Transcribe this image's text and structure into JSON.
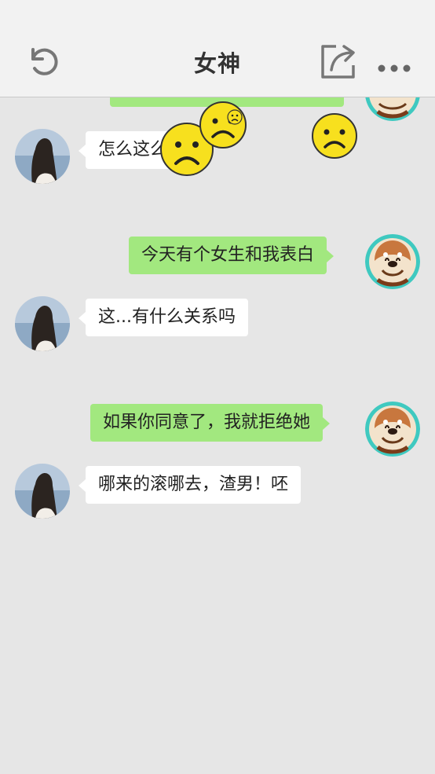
{
  "header": {
    "title": "女神",
    "back_icon": "refresh-back-icon",
    "share_icon": "share-icon",
    "more_icon": "more-dots-icon"
  },
  "messages": [
    {
      "side": "right",
      "text": "",
      "partial": true
    },
    {
      "side": "left",
      "text": "怎么这么..."
    },
    {
      "side": "right",
      "text": "今天有个女生和我表白"
    },
    {
      "side": "left",
      "text": "这...有什么关系吗"
    },
    {
      "side": "right",
      "text": "如果你同意了，我就拒绝她"
    },
    {
      "side": "left",
      "text": "哪来的滚哪去，渣男！呸"
    }
  ],
  "emojis": [
    "sad-face-emoji",
    "sad-face-emoji",
    "sad-face-emoji"
  ],
  "colors": {
    "header_bg": "#f2f2f2",
    "chat_bg": "#e6e6e6",
    "sent_bubble": "#a2e87f",
    "received_bubble": "#ffffff",
    "emoji_yellow": "#f7e01e"
  }
}
